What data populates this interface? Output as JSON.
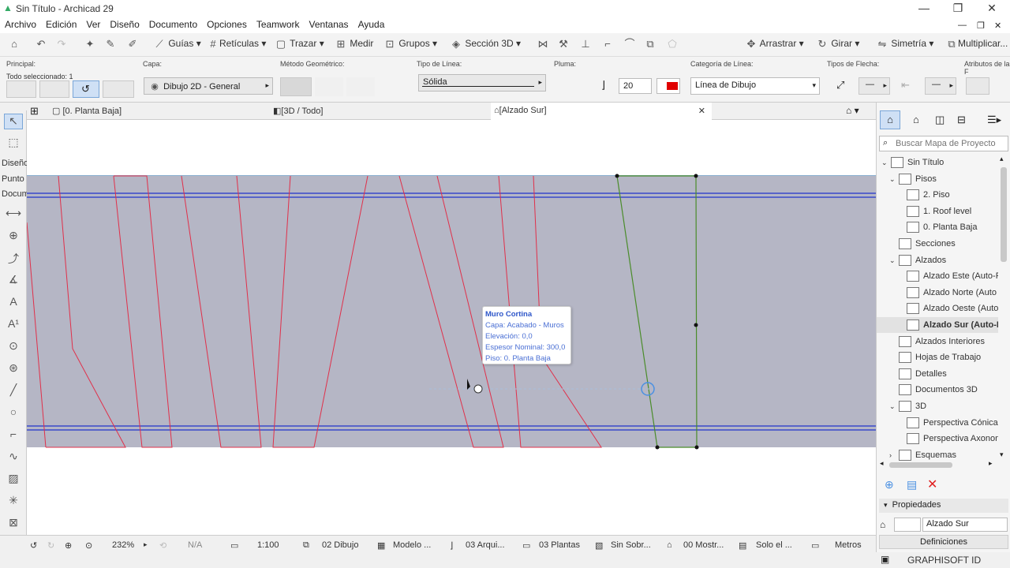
{
  "window": {
    "title": "Sin Título - Archicad 29"
  },
  "menu": [
    "Archivo",
    "Edición",
    "Ver",
    "Diseño",
    "Documento",
    "Opciones",
    "Teamwork",
    "Ventanas",
    "Ayuda"
  ],
  "toolbar": {
    "guias": "Guías",
    "reticulas": "Retículas",
    "trazar": "Trazar",
    "medir": "Medir",
    "grupos": "Grupos",
    "seccion3d": "Sección 3D",
    "arrastrar": "Arrastrar",
    "girar": "Girar",
    "simetria": "Simetría",
    "multiplicar": "Multiplicar..."
  },
  "infobox": {
    "principal_label": "Principal:",
    "selected_text": "Todo seleccionado: 1",
    "capa_label": "Capa:",
    "capa_value": "Dibujo 2D - General",
    "metodo_label": "Método Geométrico:",
    "tipo_linea_label": "Tipo de Línea:",
    "tipo_linea_value": "Sólida",
    "pluma_label": "Pluma:",
    "pluma_value": "20",
    "categoria_label": "Categoría de Línea:",
    "categoria_value": "Línea de Dibujo",
    "flecha_label": "Tipos de Flecha:",
    "atributos_label": "Atributos de la F"
  },
  "tabs": [
    {
      "label": "[0. Planta Baja]"
    },
    {
      "label": "[3D / Todo]"
    },
    {
      "label": "[Alzado Sur]"
    }
  ],
  "toolbox_labels": [
    "Diseño",
    "Punto",
    "Docum"
  ],
  "tooltip": {
    "title": "Muro Cortina",
    "lines": [
      "Capa: Acabado - Muros",
      "Elevación: 0,0",
      "Espesor Nominal: 300,0",
      "Piso: 0. Planta Baja"
    ]
  },
  "statusbar": {
    "zoom": "232%",
    "angle": "N/A",
    "scale": "1:100",
    "layers": "02 Dibujo",
    "model": "Modelo ...",
    "pens": "03 Arqui...",
    "plantas": "03 Plantas",
    "sobre": "Sin Sobr...",
    "mostrar": "00 Mostr...",
    "solo": "Solo el ...",
    "units": "Metros"
  },
  "navigator": {
    "search_placeholder": "Buscar Mapa de Proyecto",
    "items": [
      {
        "label": "Sin Título",
        "level": 0
      },
      {
        "label": "Pisos",
        "level": 1
      },
      {
        "label": "2. Piso",
        "level": 2
      },
      {
        "label": "1. Roof level",
        "level": 2
      },
      {
        "label": "0. Planta Baja",
        "level": 2
      },
      {
        "label": "Secciones",
        "level": 1
      },
      {
        "label": "Alzados",
        "level": 1
      },
      {
        "label": "Alzado Este (Auto-R",
        "level": 2
      },
      {
        "label": "Alzado Norte (Auto",
        "level": 2
      },
      {
        "label": "Alzado Oeste (Auto",
        "level": 2
      },
      {
        "label": "Alzado Sur (Auto-R",
        "level": 2
      },
      {
        "label": "Alzados Interiores",
        "level": 1
      },
      {
        "label": "Hojas de Trabajo",
        "level": 1
      },
      {
        "label": "Detalles",
        "level": 1
      },
      {
        "label": "Documentos 3D",
        "level": 1
      },
      {
        "label": "3D",
        "level": 1
      },
      {
        "label": "Perspectiva Cónica",
        "level": 2
      },
      {
        "label": "Perspectiva Axonom",
        "level": 2
      },
      {
        "label": "Esquemas",
        "level": 1
      }
    ],
    "propiedades": "Propiedades",
    "prop_value": "Alzado Sur",
    "definiciones": "Definiciones",
    "graphisoft": "GRAPHISOFT ID"
  },
  "colors": {
    "wall_red": "#e0304a",
    "wall_green": "#4a8c2a",
    "band_blue": "#2233cc",
    "canvas_fill": "#b5b6c5"
  }
}
